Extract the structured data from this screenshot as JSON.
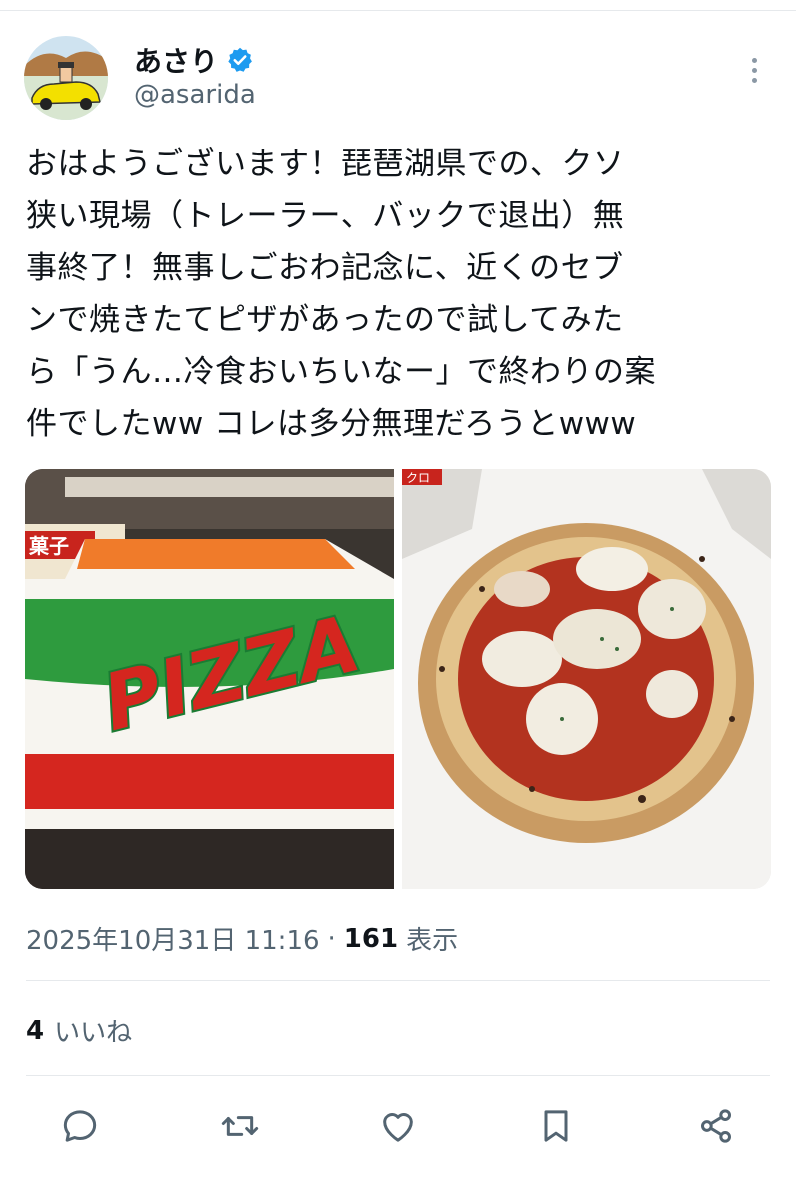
{
  "user": {
    "display_name": "あさり",
    "handle": "@asarida",
    "verified": true,
    "verified_color": "#1d9bf0"
  },
  "more_icon": "more-dots-icon",
  "tweet": {
    "text": "おはようございます！琵琶湖県での、クソ\n狭い現場（トレーラー、バックで退出）無\n事終了！無事しごおわ記念に、近くのセブ\nンで焼きたてピザがあったので試してみた\nら「うん…冷食おいちいなー」で終わりの案\n件でしたww コレは多分無理だろうとwww"
  },
  "media": {
    "left_image_text": "PIZZA",
    "left_sign_text": "菓子",
    "right_sign_text": "クロ"
  },
  "meta": {
    "timestamp": "2025年10月31日 11:16",
    "separator": "·",
    "views_count": "161",
    "views_label": "表示"
  },
  "likes": {
    "count": "4",
    "label": "いいね"
  },
  "actions": {
    "reply_icon": "reply-icon",
    "retweet_icon": "retweet-icon",
    "like_icon": "heart-icon",
    "bookmark_icon": "bookmark-icon",
    "share_icon": "share-icon",
    "icon_color": "#536471"
  }
}
